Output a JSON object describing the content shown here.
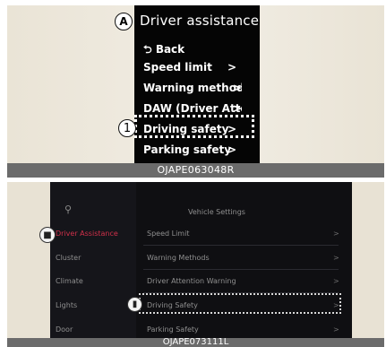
{
  "panel1": {
    "callout_a": "A",
    "title": "Driver assistance",
    "back": "Back",
    "items": [
      {
        "label": "Speed limit",
        "chevron": ">"
      },
      {
        "label": "Warning methods",
        "chevron": ">"
      },
      {
        "label": "DAW (Driver Atte",
        "chevron": ">"
      },
      {
        "label": "Driving safety",
        "chevron": ">"
      },
      {
        "label": "Parking safety",
        "chevron": ">"
      }
    ],
    "callout_1": "1",
    "caption": "OJAPE063048R"
  },
  "panel2": {
    "header": "Vehicle Settings",
    "sidebar": [
      {
        "label": "Driver Assistance",
        "active": true
      },
      {
        "label": "Cluster"
      },
      {
        "label": "Climate"
      },
      {
        "label": "Lights"
      },
      {
        "label": "Door"
      }
    ],
    "menu": [
      {
        "label": "Speed Limit",
        "chevron": ">"
      },
      {
        "label": "Warning Methods",
        "chevron": ">"
      },
      {
        "label": "Driver Attention Warning",
        "chevron": ">"
      },
      {
        "label": "Driving Safety",
        "chevron": ">"
      },
      {
        "label": "Parking Safety",
        "chevron": ">"
      }
    ],
    "caption": "OJAPE073111L"
  }
}
